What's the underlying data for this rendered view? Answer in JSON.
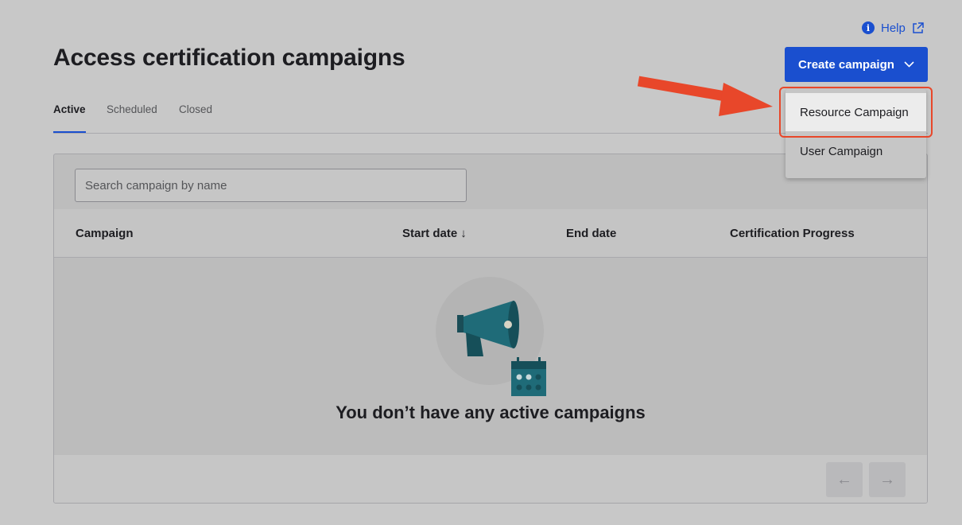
{
  "header": {
    "help_label": "Help",
    "title": "Access certification campaigns",
    "create_button_label": "Create campaign"
  },
  "tabs": [
    {
      "label": "Active",
      "active": true
    },
    {
      "label": "Scheduled",
      "active": false
    },
    {
      "label": "Closed",
      "active": false
    }
  ],
  "search": {
    "placeholder": "Search campaign by name",
    "value": ""
  },
  "table": {
    "columns": [
      "Campaign",
      "Start date",
      "End date",
      "Certification Progress"
    ],
    "sort_indicator": "↓",
    "empty_message": "You don’t have any active campaigns"
  },
  "pagination": {
    "prev": "←",
    "next": "→"
  },
  "dropdown": {
    "items": [
      {
        "label": "Resource Campaign",
        "highlighted": true
      },
      {
        "label": "User Campaign",
        "highlighted": false
      }
    ]
  },
  "colors": {
    "accent": "#1a4fcf",
    "annotation": "#e8472a",
    "illustration": "#1f6b78"
  },
  "icons": {
    "help_info": "info-icon",
    "external": "external-link-icon",
    "chevron": "chevron-down-icon",
    "megaphone": "megaphone-icon",
    "calendar": "calendar-icon"
  }
}
